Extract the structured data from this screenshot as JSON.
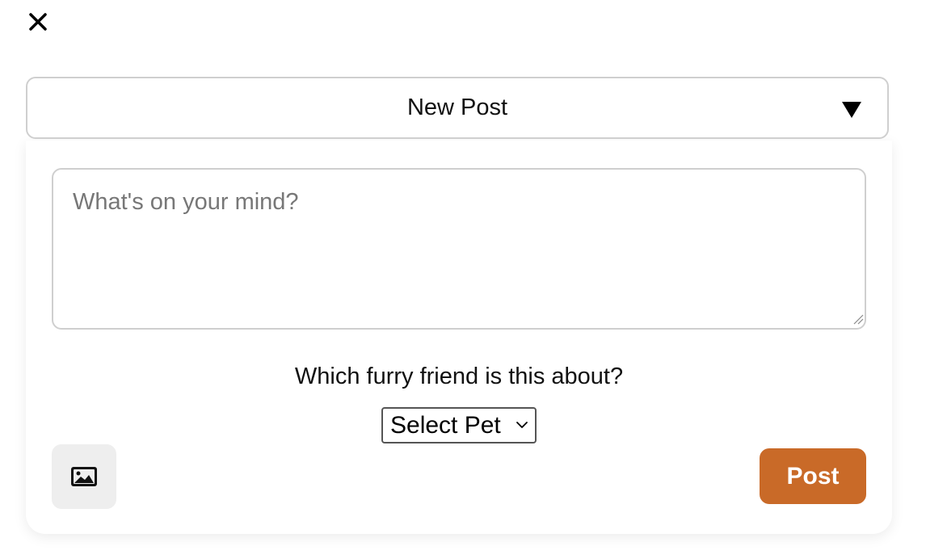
{
  "close": {
    "icon": "close-icon"
  },
  "header": {
    "title": "New Post",
    "toggle_icon": "triangle-down-icon"
  },
  "composer": {
    "placeholder": "What's on your mind?",
    "value": ""
  },
  "pet": {
    "question": "Which furry friend is this about?",
    "select_label": "Select Pet",
    "select_icon": "chevron-down-icon"
  },
  "actions": {
    "image_icon": "image-icon",
    "post_label": "Post",
    "post_color": "#c96a28"
  }
}
